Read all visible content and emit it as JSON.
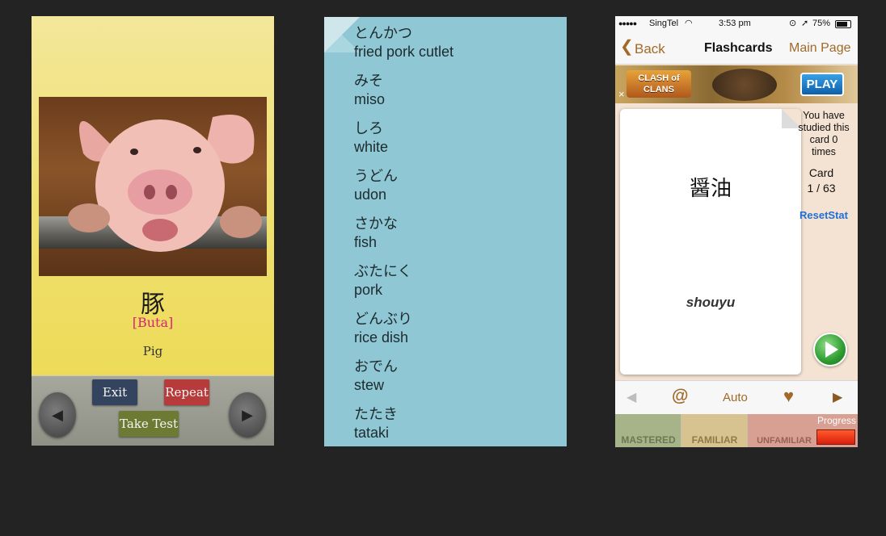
{
  "panel1": {
    "kanji": "豚",
    "reading": "[Buta]",
    "meaning": "Pig",
    "buttons": {
      "exit": "Exit",
      "repeat": "Repeat",
      "take_test": "Take Test"
    },
    "colors": {
      "exit": "#34445e",
      "repeat": "#b73b3a",
      "take_test": "#6d7a34",
      "reading": "#d8237a"
    }
  },
  "panel2": {
    "entries": [
      {
        "kana": "とんかつ",
        "english": "fried pork cutlet"
      },
      {
        "kana": "みそ",
        "english": "miso"
      },
      {
        "kana": "しろ",
        "english": "white"
      },
      {
        "kana": "うどん",
        "english": "udon"
      },
      {
        "kana": "さかな",
        "english": "fish"
      },
      {
        "kana": "ぶたにく",
        "english": "pork"
      },
      {
        "kana": "どんぶり",
        "english": "rice dish"
      },
      {
        "kana": "おでん",
        "english": "stew"
      },
      {
        "kana": "たたき",
        "english": "tataki"
      }
    ]
  },
  "panel3": {
    "status": {
      "carrier": "SingTel",
      "time": "3:53 pm",
      "battery": "75%"
    },
    "nav": {
      "back": "Back",
      "title": "Flashcards",
      "main_page": "Main Page"
    },
    "ad": {
      "brand": "CLASH of CLANS",
      "play": "PLAY",
      "close": "×"
    },
    "card": {
      "word": "醤油",
      "romaji": "shouyu"
    },
    "studied_text": "You have studied this card 0 times",
    "card_label": "Card",
    "card_position": "1 / 63",
    "reset_stat": "ResetStat",
    "toolbar": {
      "at": "@",
      "auto": "Auto",
      "heart": "♥"
    },
    "bottom": {
      "mastered": "MASTERED",
      "familiar": "FAMILIAR",
      "unfamiliar": "UNFAMILIAR",
      "progress": "Progress"
    },
    "colors": {
      "accent": "#a06a2a",
      "link": "#1f6fd6",
      "play": "#2e9b2f"
    }
  }
}
